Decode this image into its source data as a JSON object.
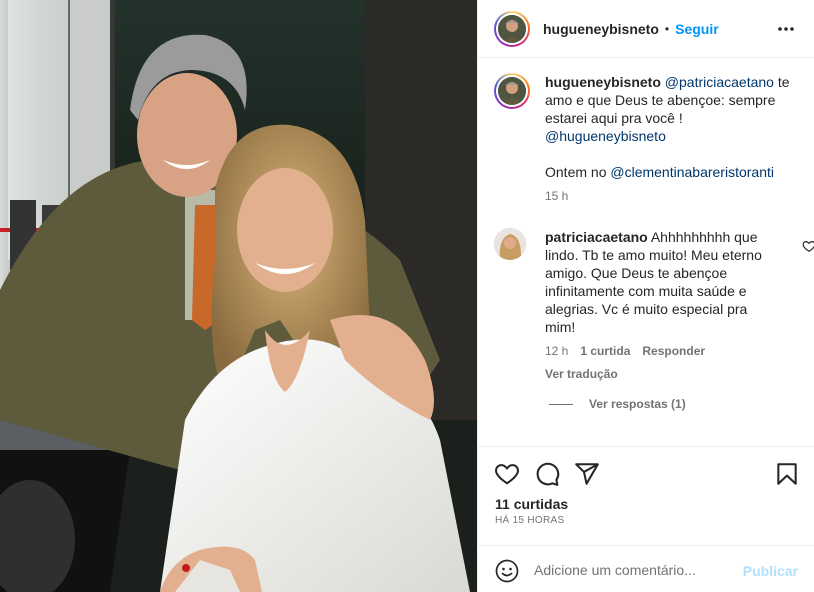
{
  "post": {
    "username": "hugueneybisneto",
    "follow_label": "Seguir",
    "dot": "•"
  },
  "caption": {
    "username": "hugueneybisneto",
    "mention": "@patriciacaetano",
    "text": " te amo e que Deus te abençoe: sempre estarei aqui pra você !",
    "self_mention": "@hugueneybisneto",
    "location_prefix": "Ontem no ",
    "location_mention": "@clementinabareristoranti",
    "time": "15 h"
  },
  "reply": {
    "username": "patriciacaetano",
    "text": " Ahhhhhhhhh que lindo. Tb te amo muito! Meu eterno amigo. Que Deus te abençoe infinitamente com muita saúde e alegrias. Vc é muito especial pra mim!",
    "time": "12 h",
    "likes": "1 curtida",
    "reply_label": "Responder",
    "translate_label": "Ver tradução",
    "view_replies_label": "Ver respostas (1)"
  },
  "actions": {
    "likes": "11 curtidas",
    "posted": "HÁ 15 HORAS"
  },
  "comment_box": {
    "placeholder": "Adicione um comentário...",
    "publish_label": "Publicar"
  },
  "colors": {
    "link_blue": "#0095f6",
    "mention_blue": "#00376b",
    "muted": "#737373",
    "publish_disabled": "#b2dffc"
  },
  "icons": [
    "more-options-icon",
    "heart-icon",
    "comment-icon",
    "share-icon",
    "bookmark-icon",
    "emoji-icon",
    "small-heart-icon"
  ]
}
